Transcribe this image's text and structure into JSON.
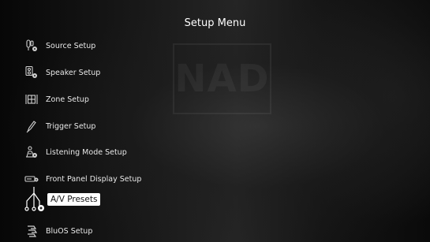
{
  "title": "Setup Menu",
  "watermark": "NAD",
  "menu": {
    "items": [
      {
        "label": "Source Setup",
        "icon": "source-setup-icon"
      },
      {
        "label": "Speaker Setup",
        "icon": "speaker-setup-icon"
      },
      {
        "label": "Zone Setup",
        "icon": "zone-setup-icon"
      },
      {
        "label": "Trigger Setup",
        "icon": "trigger-setup-icon"
      },
      {
        "label": "Listening Mode Setup",
        "icon": "listening-mode-icon"
      },
      {
        "label": "Front Panel Display Setup",
        "icon": "front-panel-display-icon"
      },
      {
        "label": "A/V Presets",
        "icon": "av-presets-icon",
        "selected": true
      },
      {
        "label": "BluOS Setup",
        "icon": "bluos-icon"
      }
    ]
  },
  "colors": {
    "text": "#e8e8e8",
    "highlight_bg": "#ffffff",
    "highlight_text": "#111111"
  }
}
